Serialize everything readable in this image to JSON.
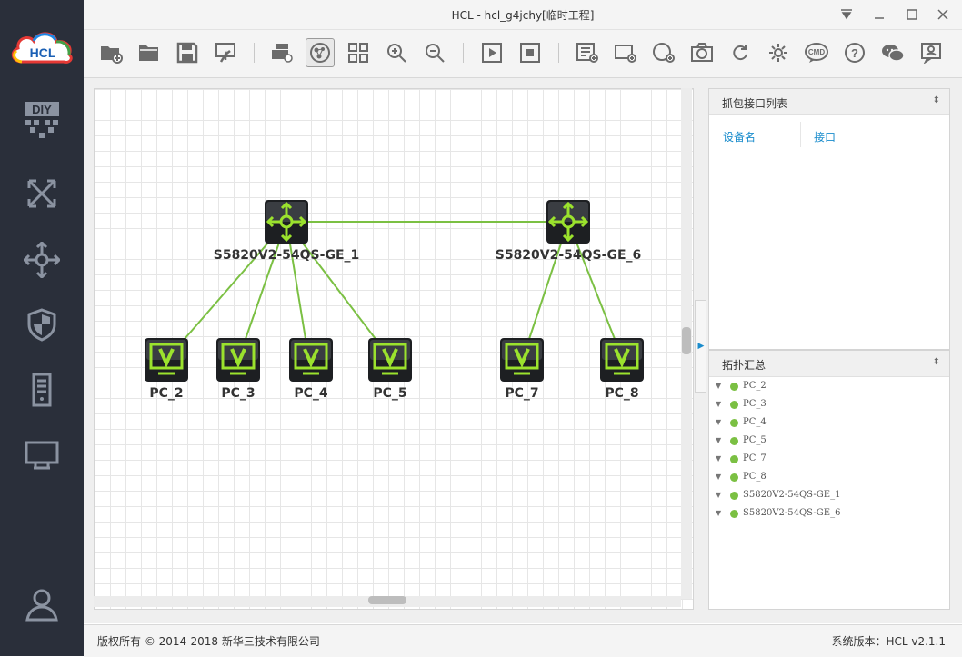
{
  "window": {
    "title": "HCL - hcl_g4jchy[临时工程]"
  },
  "logo": {
    "text": "HCL"
  },
  "sidebar": {
    "items": [
      {
        "name": "diy"
      },
      {
        "name": "switch"
      },
      {
        "name": "router"
      },
      {
        "name": "firewall"
      },
      {
        "name": "server"
      },
      {
        "name": "terminal"
      }
    ],
    "user": "user"
  },
  "canvas": {
    "switches": [
      {
        "id": "sw1",
        "label": "S5820V2-54QS-GE_1"
      },
      {
        "id": "sw6",
        "label": "S5820V2-54QS-GE_6"
      }
    ],
    "pcs": [
      {
        "id": "pc2",
        "label": "PC_2"
      },
      {
        "id": "pc3",
        "label": "PC_3"
      },
      {
        "id": "pc4",
        "label": "PC_4"
      },
      {
        "id": "pc5",
        "label": "PC_5"
      },
      {
        "id": "pc7",
        "label": "PC_7"
      },
      {
        "id": "pc8",
        "label": "PC_8"
      }
    ],
    "link_color": "#7bc043"
  },
  "capture_panel": {
    "title": "抓包接口列表",
    "columns": [
      "设备名",
      "接口"
    ]
  },
  "topology_panel": {
    "title": "拓扑汇总",
    "items": [
      "PC_2",
      "PC_3",
      "PC_4",
      "PC_5",
      "PC_7",
      "PC_8",
      "S5820V2-54QS-GE_1",
      "S5820V2-54QS-GE_6"
    ]
  },
  "footer": {
    "copyright": "版权所有 © 2014-2018 新华三技术有限公司",
    "version": "系统版本：HCL v2.1.1"
  },
  "colors": {
    "accent": "#1a8ccc",
    "online": "#7bc043",
    "sidebar": "#2a2f3a"
  }
}
